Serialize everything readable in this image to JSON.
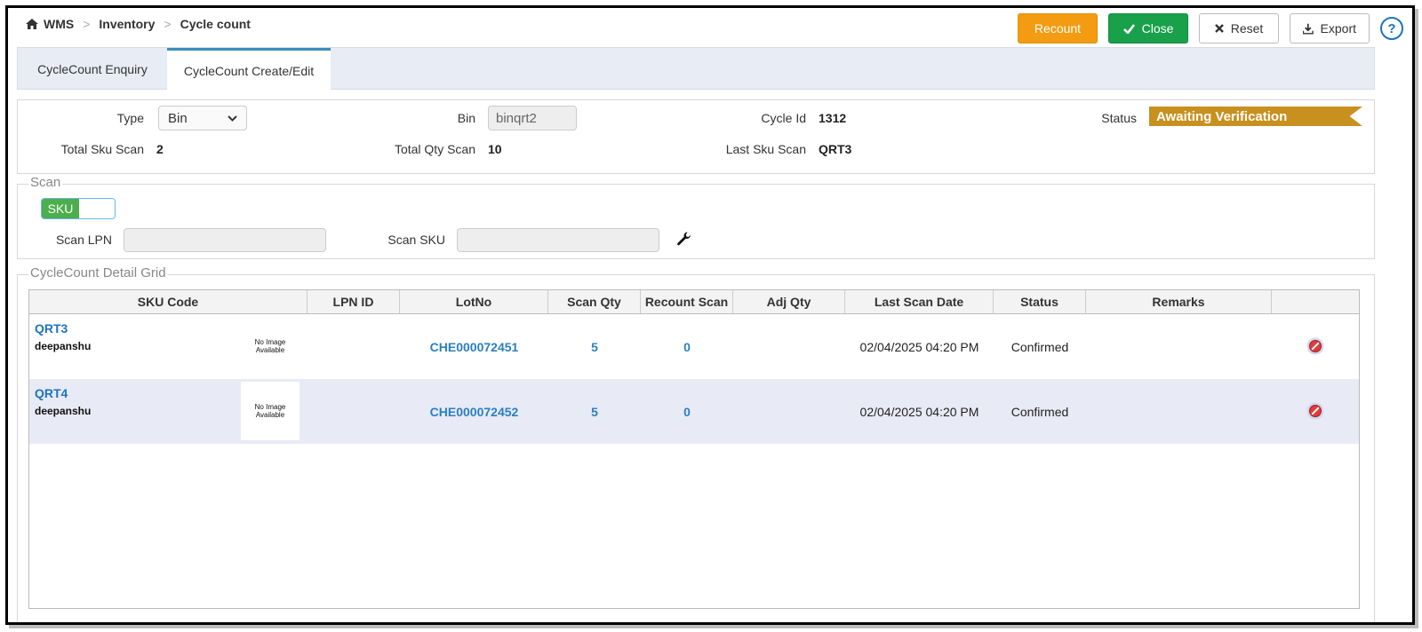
{
  "breadcrumb": {
    "home": "WMS",
    "level1": "Inventory",
    "level2": "Cycle count",
    "separator": ">"
  },
  "toolbar": {
    "recount": "Recount",
    "close": "Close",
    "reset": "Reset",
    "export": "Export",
    "help": "?"
  },
  "tabs": [
    {
      "label": "CycleCount Enquiry"
    },
    {
      "label": "CycleCount Create/Edit"
    }
  ],
  "info": {
    "type_label": "Type",
    "type_value": "Bin",
    "bin_label": "Bin",
    "bin_value": "binqrt2",
    "cycle_id_label": "Cycle Id",
    "cycle_id_value": "1312",
    "status_label": "Status",
    "status_value": "Awaiting Verification",
    "total_sku_label": "Total Sku Scan",
    "total_sku_value": "2",
    "total_qty_label": "Total Qty Scan",
    "total_qty_value": "10",
    "last_sku_label": "Last Sku Scan",
    "last_sku_value": "QRT3"
  },
  "scan": {
    "legend": "Scan",
    "toggle_label": "SKU",
    "lpn_label": "Scan LPN",
    "sku_label": "Scan SKU"
  },
  "grid": {
    "legend": "CycleCount Detail  Grid",
    "columns": [
      "SKU Code",
      "LPN ID",
      "LotNo",
      "Scan Qty",
      "Recount Scan",
      "Adj Qty",
      "Last Scan Date",
      "Status",
      "Remarks",
      ""
    ],
    "no_image_line1": "No Image",
    "no_image_line2": "Available",
    "rows": [
      {
        "sku": "QRT3",
        "desc": "deepanshu",
        "lpn": "",
        "lot": "CHE000072451",
        "scan_qty": "5",
        "recount": "0",
        "adj_qty": "",
        "date": "02/04/2025 04:20 PM",
        "status": "Confirmed",
        "remarks": ""
      },
      {
        "sku": "QRT4",
        "desc": "deepanshu",
        "lpn": "",
        "lot": "CHE000072452",
        "scan_qty": "5",
        "recount": "0",
        "adj_qty": "",
        "date": "02/04/2025 04:20 PM",
        "status": "Confirmed",
        "remarks": ""
      }
    ]
  },
  "colors": {
    "recount": "#f39c12",
    "close": "#19a04b",
    "status_badge": "#c8901e",
    "link": "#2a7fc0",
    "toggle_on": "#4cae4c"
  }
}
